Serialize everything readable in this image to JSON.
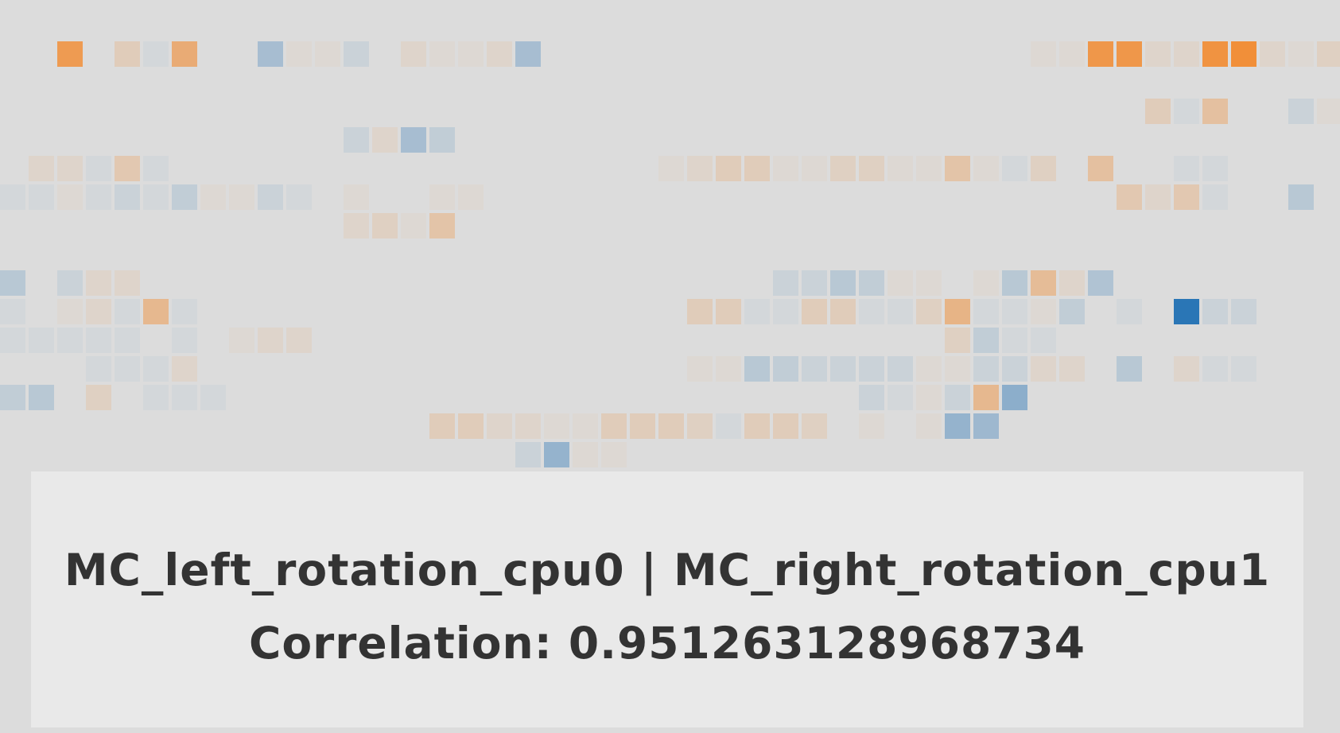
{
  "chart_data": {
    "type": "heatmap",
    "color_scale": {
      "negative": "#2a76b6",
      "neutral": "#dcdcdc",
      "positive": "#f28b30",
      "domain": [
        -1,
        1
      ]
    },
    "rows": [
      {
        "row": 0,
        "cells": [
          [
            2,
            0.8
          ],
          [
            4,
            0.2
          ],
          [
            5,
            -0.05
          ],
          [
            6,
            0.6
          ],
          [
            9,
            -0.3
          ],
          [
            10,
            0.05
          ],
          [
            11,
            0.05
          ],
          [
            12,
            -0.1
          ],
          [
            14,
            0.1
          ],
          [
            15,
            0.05
          ],
          [
            16,
            0.05
          ],
          [
            17,
            0.1
          ],
          [
            18,
            -0.3
          ],
          [
            36,
            0.05
          ],
          [
            37,
            0.05
          ],
          [
            38,
            0.85
          ],
          [
            39,
            0.85
          ],
          [
            40,
            0.1
          ],
          [
            41,
            0.1
          ],
          [
            42,
            0.9
          ],
          [
            43,
            0.95
          ],
          [
            44,
            0.1
          ],
          [
            45,
            0.05
          ],
          [
            46,
            0.15
          ]
        ]
      },
      {
        "row": 2,
        "cells": [
          [
            40,
            0.2
          ],
          [
            41,
            -0.05
          ],
          [
            42,
            0.35
          ],
          [
            45,
            -0.1
          ],
          [
            46,
            0.05
          ]
        ]
      },
      {
        "row": 3,
        "cells": [
          [
            12,
            -0.1
          ],
          [
            13,
            0.1
          ],
          [
            14,
            -0.3
          ],
          [
            15,
            -0.15
          ]
        ]
      },
      {
        "row": 4,
        "cells": [
          [
            1,
            0.1
          ],
          [
            2,
            0.1
          ],
          [
            3,
            -0.05
          ],
          [
            4,
            0.25
          ],
          [
            5,
            -0.05
          ],
          [
            23,
            0.05
          ],
          [
            24,
            0.1
          ],
          [
            25,
            0.2
          ],
          [
            26,
            0.2
          ],
          [
            27,
            0.05
          ],
          [
            28,
            0.05
          ],
          [
            29,
            0.15
          ],
          [
            30,
            0.15
          ],
          [
            31,
            0.05
          ],
          [
            32,
            0.05
          ],
          [
            33,
            0.3
          ],
          [
            34,
            0.05
          ],
          [
            35,
            -0.05
          ],
          [
            36,
            0.15
          ],
          [
            38,
            0.35
          ],
          [
            41,
            -0.05
          ],
          [
            42,
            -0.05
          ]
        ]
      },
      {
        "row": 5,
        "cells": [
          [
            0,
            -0.05
          ],
          [
            1,
            -0.05
          ],
          [
            2,
            0.05
          ],
          [
            3,
            -0.05
          ],
          [
            4,
            -0.1
          ],
          [
            5,
            -0.05
          ],
          [
            6,
            -0.15
          ],
          [
            7,
            0.05
          ],
          [
            8,
            0.05
          ],
          [
            9,
            -0.1
          ],
          [
            10,
            -0.05
          ],
          [
            12,
            0.05
          ],
          [
            15,
            0.05
          ],
          [
            16,
            0.05
          ],
          [
            39,
            0.25
          ],
          [
            40,
            0.1
          ],
          [
            41,
            0.25
          ],
          [
            42,
            -0.05
          ],
          [
            45,
            -0.2
          ]
        ]
      },
      {
        "row": 6,
        "cells": [
          [
            12,
            0.1
          ],
          [
            13,
            0.15
          ],
          [
            14,
            0.05
          ],
          [
            15,
            0.3
          ]
        ]
      },
      {
        "row": 8,
        "cells": [
          [
            0,
            -0.2
          ],
          [
            2,
            -0.1
          ],
          [
            3,
            0.1
          ],
          [
            4,
            0.1
          ],
          [
            27,
            -0.1
          ],
          [
            28,
            -0.1
          ],
          [
            29,
            -0.2
          ],
          [
            30,
            -0.15
          ],
          [
            31,
            0.05
          ],
          [
            32,
            0.05
          ],
          [
            34,
            0.05
          ],
          [
            35,
            -0.2
          ],
          [
            36,
            0.4
          ],
          [
            37,
            0.1
          ],
          [
            38,
            -0.25
          ]
        ]
      },
      {
        "row": 9,
        "cells": [
          [
            0,
            -0.05
          ],
          [
            2,
            0.05
          ],
          [
            3,
            0.1
          ],
          [
            4,
            -0.05
          ],
          [
            5,
            0.45
          ],
          [
            6,
            -0.05
          ],
          [
            24,
            0.2
          ],
          [
            25,
            0.2
          ],
          [
            26,
            -0.05
          ],
          [
            27,
            -0.05
          ],
          [
            28,
            0.2
          ],
          [
            29,
            0.2
          ],
          [
            30,
            -0.05
          ],
          [
            31,
            -0.05
          ],
          [
            32,
            0.15
          ],
          [
            33,
            0.5
          ],
          [
            34,
            -0.05
          ],
          [
            35,
            -0.05
          ],
          [
            36,
            0.05
          ],
          [
            37,
            -0.15
          ],
          [
            39,
            -0.05
          ],
          [
            41,
            -1.0
          ],
          [
            42,
            -0.1
          ],
          [
            43,
            -0.1
          ]
        ]
      },
      {
        "row": 10,
        "cells": [
          [
            0,
            -0.05
          ],
          [
            1,
            -0.05
          ],
          [
            2,
            -0.05
          ],
          [
            3,
            -0.05
          ],
          [
            4,
            -0.05
          ],
          [
            6,
            -0.05
          ],
          [
            8,
            0.05
          ],
          [
            9,
            0.1
          ],
          [
            10,
            0.1
          ],
          [
            33,
            0.15
          ],
          [
            34,
            -0.15
          ],
          [
            35,
            -0.05
          ],
          [
            36,
            -0.05
          ]
        ]
      },
      {
        "row": 11,
        "cells": [
          [
            3,
            -0.05
          ],
          [
            4,
            -0.05
          ],
          [
            5,
            -0.05
          ],
          [
            6,
            0.1
          ],
          [
            24,
            0.05
          ],
          [
            25,
            0.05
          ],
          [
            26,
            -0.2
          ],
          [
            27,
            -0.15
          ],
          [
            28,
            -0.1
          ],
          [
            29,
            -0.1
          ],
          [
            30,
            -0.1
          ],
          [
            31,
            -0.1
          ],
          [
            32,
            0.05
          ],
          [
            33,
            0.05
          ],
          [
            34,
            -0.1
          ],
          [
            35,
            -0.1
          ],
          [
            36,
            0.1
          ],
          [
            37,
            0.1
          ],
          [
            39,
            -0.2
          ],
          [
            41,
            0.1
          ],
          [
            42,
            -0.05
          ],
          [
            43,
            -0.05
          ]
        ]
      },
      {
        "row": 12,
        "cells": [
          [
            0,
            -0.15
          ],
          [
            1,
            -0.2
          ],
          [
            3,
            0.15
          ],
          [
            5,
            -0.05
          ],
          [
            6,
            -0.05
          ],
          [
            7,
            -0.05
          ],
          [
            30,
            -0.1
          ],
          [
            31,
            -0.05
          ],
          [
            32,
            0.05
          ],
          [
            33,
            -0.1
          ],
          [
            34,
            0.45
          ],
          [
            35,
            -0.45
          ]
        ]
      },
      {
        "row": 13,
        "cells": [
          [
            15,
            0.2
          ],
          [
            16,
            0.2
          ],
          [
            17,
            0.1
          ],
          [
            18,
            0.1
          ],
          [
            19,
            0.05
          ],
          [
            20,
            0.05
          ],
          [
            21,
            0.2
          ],
          [
            22,
            0.2
          ],
          [
            23,
            0.2
          ],
          [
            24,
            0.15
          ],
          [
            25,
            -0.05
          ],
          [
            26,
            0.2
          ],
          [
            27,
            0.2
          ],
          [
            28,
            0.15
          ],
          [
            30,
            0.05
          ],
          [
            32,
            0.05
          ],
          [
            33,
            -0.4
          ],
          [
            34,
            -0.35
          ]
        ]
      },
      {
        "row": 14,
        "cells": [
          [
            18,
            -0.1
          ],
          [
            19,
            -0.4
          ],
          [
            20,
            0.05
          ],
          [
            21,
            0.05
          ]
        ]
      }
    ]
  },
  "tooltip": {
    "pair_label": "MC_left_rotation_cpu0 | MC_right_rotation_cpu1",
    "correlation_text": "Correlation: 0.951263128968734"
  }
}
